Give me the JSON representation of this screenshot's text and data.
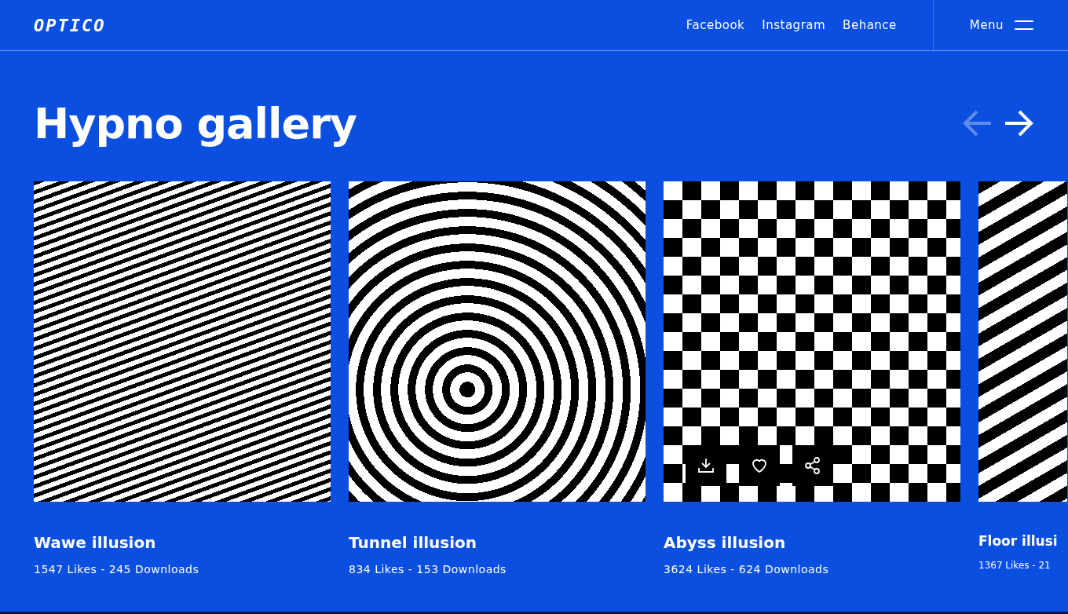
{
  "header": {
    "logo": "OPTICO",
    "links": [
      "Facebook",
      "Instagram",
      "Behance"
    ],
    "menu": {
      "label": "Menu"
    }
  },
  "title": "Hypno gallery",
  "arrows": [
    {
      "kind": "previous",
      "disabled": true
    },
    {
      "kind": "next",
      "disabled": false
    }
  ],
  "cards": [
    {
      "title": "Wawe illusion",
      "stats": "1547 Likes - 245 Downloads",
      "kind": "waves",
      "show_actions": false
    },
    {
      "title": "Tunnel illusion",
      "stats": "834 Likes - 153 Downloads",
      "kind": "tunnel",
      "show_actions": false
    },
    {
      "title": "Abyss illusion",
      "stats": "3624 Likes - 624 Downloads",
      "kind": "checker",
      "show_actions": true
    },
    {
      "title": "Floor illusi",
      "stats": "1367 Likes - 21",
      "kind": "stripes",
      "show_actions": false
    }
  ]
}
